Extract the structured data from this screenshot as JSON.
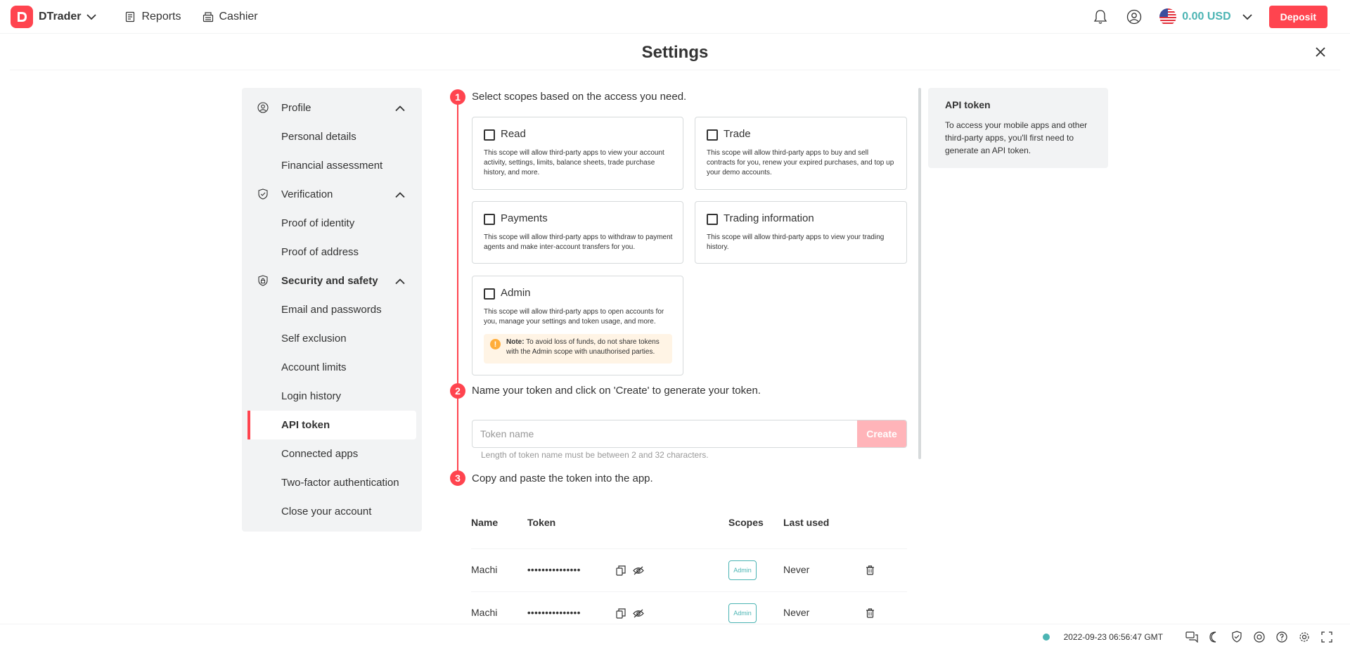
{
  "header": {
    "brand": "DTrader",
    "nav": [
      {
        "label": "Reports",
        "icon": "reports-icon"
      },
      {
        "label": "Cashier",
        "icon": "cashier-icon"
      }
    ],
    "account": {
      "balance": "0.00 USD",
      "flag": "us-flag-icon"
    },
    "deposit_label": "Deposit"
  },
  "settings": {
    "title": "Settings"
  },
  "sidebar": {
    "groups": [
      {
        "label": "Profile",
        "icon": "profile-icon",
        "items": [
          "Personal details",
          "Financial assessment"
        ]
      },
      {
        "label": "Verification",
        "icon": "shield-check-icon",
        "items": [
          "Proof of identity",
          "Proof of address"
        ]
      },
      {
        "label": "Security and safety",
        "icon": "security-icon",
        "items": [
          "Email and passwords",
          "Self exclusion",
          "Account limits",
          "Login history",
          "API token",
          "Connected apps",
          "Two-factor authentication",
          "Close your account"
        ]
      }
    ],
    "active_item": "API token"
  },
  "steps": [
    {
      "num": "1",
      "text": "Select scopes based on the access you need."
    },
    {
      "num": "2",
      "text": "Name your token and click on 'Create' to generate your token."
    },
    {
      "num": "3",
      "text": "Copy and paste the token into the app."
    }
  ],
  "scopes": [
    {
      "title": "Read",
      "desc": "This scope will allow third-party apps to view your account activity, settings, limits, balance sheets, trade purchase history, and more."
    },
    {
      "title": "Trade",
      "desc": "This scope will allow third-party apps to buy and sell contracts for you, renew your expired purchases, and top up your demo accounts."
    },
    {
      "title": "Payments",
      "desc": "This scope will allow third-party apps to withdraw to payment agents and make inter-account transfers for you."
    },
    {
      "title": "Trading information",
      "desc": "This scope will allow third-party apps to view your trading history."
    },
    {
      "title": "Admin",
      "desc": "This scope will allow third-party apps to open accounts for you, manage your settings and token usage, and more."
    }
  ],
  "admin_note": {
    "label": "Note:",
    "text": "To avoid loss of funds, do not share tokens with the Admin scope with unauthorised parties."
  },
  "token_form": {
    "placeholder": "Token name",
    "create_label": "Create",
    "hint": "Length of token name must be between 2 and 32 characters."
  },
  "token_table": {
    "columns": [
      "Name",
      "Token",
      "Scopes",
      "Last used"
    ],
    "rows": [
      {
        "name": "Machi",
        "token": "•••••••••••••••",
        "scope": "Admin",
        "last_used": "Never"
      },
      {
        "name": "Machi",
        "token": "•••••••••••••••",
        "scope": "Admin",
        "last_used": "Never"
      }
    ]
  },
  "info": {
    "title": "API token",
    "text": "To access your mobile apps and other third-party apps, you'll first need to generate an API token."
  },
  "footer": {
    "timestamp": "2022-09-23 06:56:47 GMT",
    "icons": [
      "chat-icon",
      "theme-icon",
      "responsible-trading-icon",
      "help-center-icon",
      "help-icon",
      "settings-icon",
      "fullscreen-icon"
    ]
  },
  "colors": {
    "brand": "#ff444f",
    "accent": "#4bb4b3",
    "panel": "#f2f3f4",
    "warning": "#ffad3a"
  }
}
